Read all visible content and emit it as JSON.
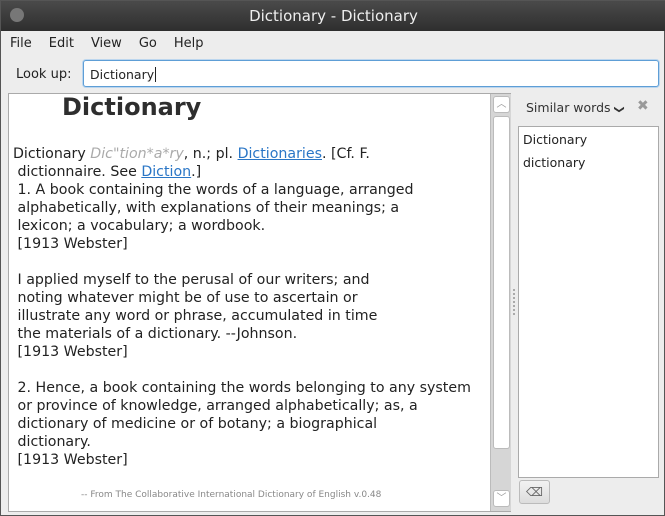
{
  "window": {
    "title": "Dictionary - Dictionary"
  },
  "menu": [
    "File",
    "Edit",
    "View",
    "Go",
    "Help"
  ],
  "lookup": {
    "label": "Look up:",
    "value": "Dictionary"
  },
  "entry": {
    "headword": "Dictionary",
    "word": "Dictionary",
    "pronunciation": "Dic\"tion*a*ry",
    "l1a": ", n.; pl. ",
    "link1": "Dictionaries",
    "l1b": ". [Cf. F.",
    "l2a": " dictionnaire. See ",
    "link2": "Diction",
    "l2b": ".]",
    "rest": " 1. A book containing the words of a language, arranged\n alphabetically, with explanations of their meanings; a\n lexicon; a vocabulary; a wordbook.\n [1913 Webster]\n\n I applied myself to the perusal of our writers; and\n noting whatever might be of use to ascertain or\n illustrate any word or phrase, accumulated in time\n the materials of a dictionary. --Johnson.\n [1913 Webster]\n\n 2. Hence, a book containing the words belonging to any system\n or province of knowledge, arranged alphabetically; as, a\n dictionary of medicine or of botany; a biographical\n dictionary.\n [1913 Webster]",
    "source": "-- From The Collaborative International Dictionary of English v.0.48"
  },
  "similar": {
    "title": "Similar words",
    "chevron": "❯",
    "close": "✖",
    "items": [
      "Dictionary",
      "dictionary"
    ],
    "clear_icon": "⌫"
  }
}
